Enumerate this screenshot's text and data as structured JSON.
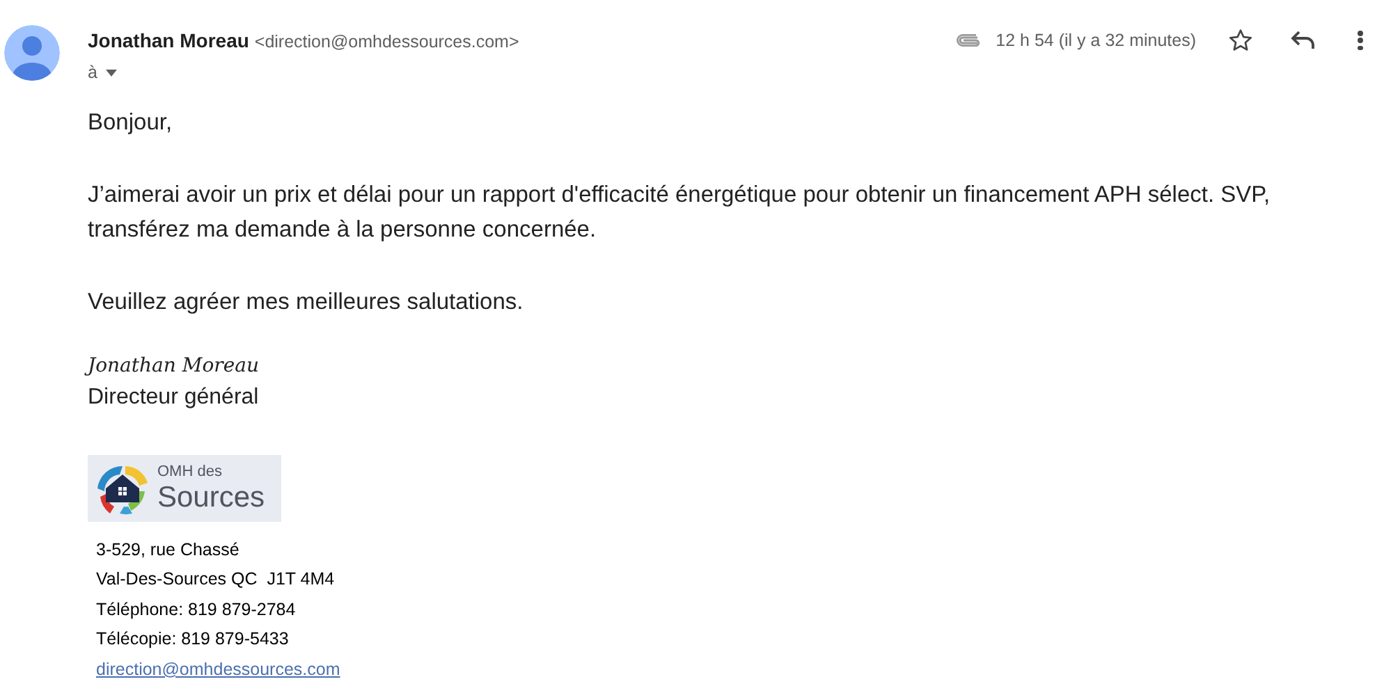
{
  "sender": {
    "name": "Jonathan Moreau",
    "email": "<direction@omhdessources.com>",
    "recipient_label": "à"
  },
  "time": "12 h 54 (il y a 32 minutes)",
  "starred": false,
  "body": [
    "Bonjour,",
    "J’aimerai avoir un prix et délai pour un rapport d'efficacité énergétique pour obtenir un financement APH sélect. SVP, transférez ma demande à la personne concernée.",
    "Veuillez agréer mes meilleures salutations."
  ],
  "signature": {
    "name": "Jonathan Moreau",
    "title": "Directeur général",
    "logo": {
      "line_1": "OMH des",
      "line_2": "Sources"
    },
    "address": [
      "3-529, rue Chassé",
      "Val-Des-Sources QC  J1T 4M4",
      "Téléphone: 819 879-2784",
      "Télécopie: 819 879-5433"
    ],
    "email_link": "direction@omhdessources.com"
  }
}
